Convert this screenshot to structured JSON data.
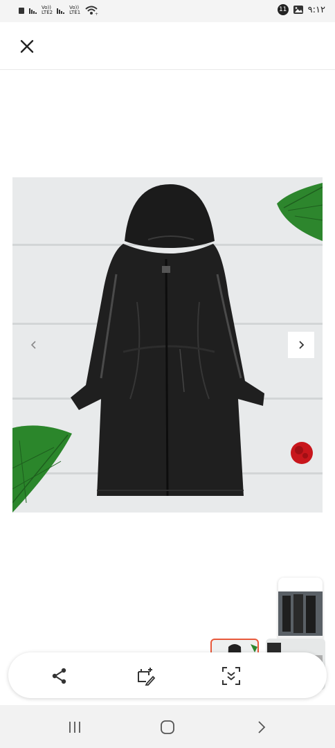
{
  "status_bar": {
    "sim1_label_top": "Vo))",
    "sim1_label_bottom": "LTE2",
    "sim2_label_top": "Vo))",
    "sim2_label_bottom": "LTE1",
    "notification_count": "11",
    "time": "۹:۱۲"
  },
  "icons": {
    "close": "close-icon",
    "share": "share-icon",
    "edit": "crop-edit-icon",
    "lens": "visual-search-icon",
    "prev": "chevron-left-icon",
    "next": "chevron-right-icon",
    "nav_recents": "recents-icon",
    "nav_home": "home-icon",
    "nav_back": "back-icon"
  },
  "colors": {
    "selected_thumb_border": "#e8583a",
    "leaf_green": "#2e8b2e",
    "coat": "#1c1c1c"
  }
}
